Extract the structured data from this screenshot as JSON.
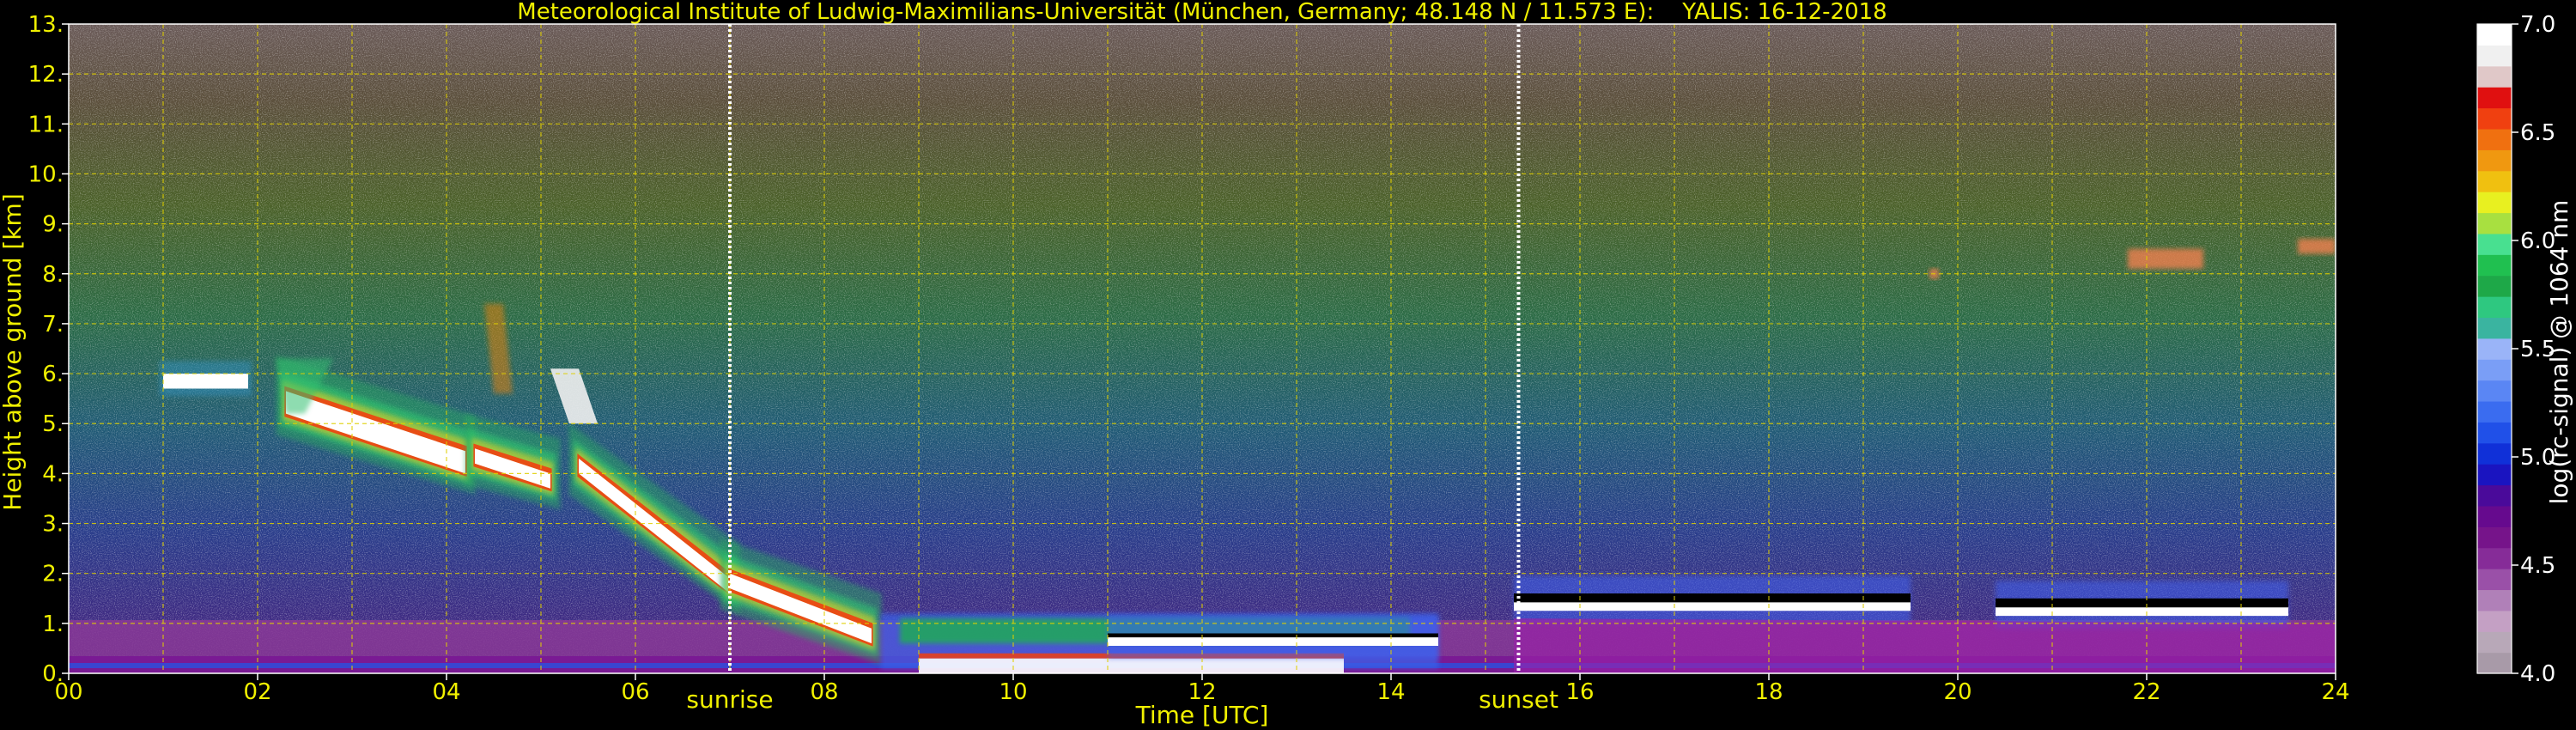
{
  "chart_data": {
    "type": "heatmap",
    "title": "Meteorological Institute of Ludwig-Maximilians-Universität (München, Germany; 48.148 N / 11.573 E):    YALIS: 16-12-2018",
    "xlabel": "Time [UTC]",
    "ylabel": "Height above ground [km]",
    "xlim": [
      0,
      24
    ],
    "ylim": [
      0,
      13
    ],
    "x_ticks": [
      "00",
      "02",
      "04",
      "06",
      "08",
      "10",
      "12",
      "14",
      "16",
      "18",
      "20",
      "22",
      "24"
    ],
    "y_ticks": [
      "0.",
      "1.",
      "2.",
      "3.",
      "4.",
      "5.",
      "6.",
      "7.",
      "8.",
      "9.",
      "10.",
      "11.",
      "12.",
      "13."
    ],
    "grid": true,
    "grid_style": "dashed yellow",
    "colorbar": {
      "label": "log(rc-signal) @ 1064 nm",
      "range": [
        4.0,
        7.0
      ],
      "ticks": [
        "4.0",
        "4.5",
        "5.0",
        "5.5",
        "6.0",
        "6.5",
        "7.0"
      ],
      "colors": [
        "#a89aa8",
        "#b8a8b8",
        "#c4a0c4",
        "#b080b8",
        "#9a50a8",
        "#862c98",
        "#76148a",
        "#660a8e",
        "#4a0a9a",
        "#1a14c0",
        "#1030d8",
        "#2050e8",
        "#3a6cf0",
        "#5a86f4",
        "#7a9ef6",
        "#9ab4f8",
        "#3ab4a0",
        "#2ec880",
        "#1ea848",
        "#20c050",
        "#48e090",
        "#a8e040",
        "#e8f020",
        "#f0c010",
        "#f09810",
        "#f07010",
        "#f04010",
        "#e01010",
        "#e0c8c8",
        "#f0f0f0",
        "#ffffff"
      ]
    },
    "markers": [
      {
        "label": "sunrise",
        "x": 7.0
      },
      {
        "label": "sunset",
        "x": 15.35
      }
    ],
    "features": [
      {
        "name": "high ice cloud",
        "t_start": 1.0,
        "t_end": 1.9,
        "h_base": 5.7,
        "h_top": 6.1
      },
      {
        "name": "sloping cloud layer",
        "t_start": 2.3,
        "t_end": 4.2,
        "h_start": 5.2,
        "h_end": 4.0
      },
      {
        "name": "descending cloud layer",
        "t_start": 4.3,
        "t_end": 8.5,
        "h_start": 4.2,
        "h_end": 0.5
      },
      {
        "name": "low stratus",
        "t_start": 11.0,
        "t_end": 14.5,
        "h_base": 0.6,
        "h_top": 0.8
      },
      {
        "name": "low stratus",
        "t_start": 15.3,
        "t_end": 19.5,
        "h_base": 1.3,
        "h_top": 1.6
      },
      {
        "name": "low stratus",
        "t_start": 20.4,
        "t_end": 23.5,
        "h_base": 1.2,
        "h_top": 1.5
      },
      {
        "name": "cirrus patches",
        "t_start": 21.8,
        "t_end": 24.0,
        "h_base": 7.9,
        "h_top": 8.6
      }
    ]
  }
}
